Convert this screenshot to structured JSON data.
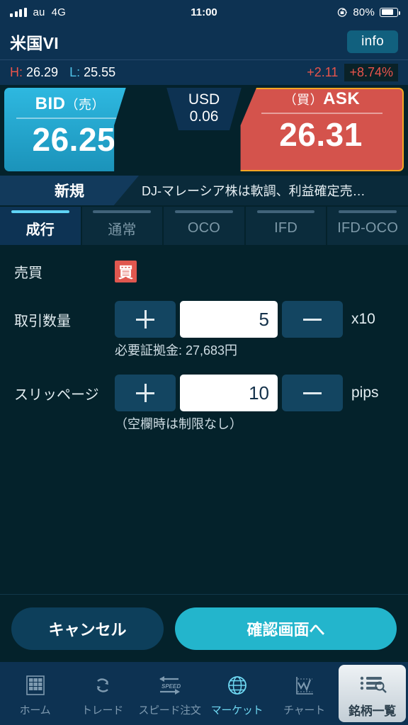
{
  "status_bar": {
    "carrier": "au",
    "network": "4G",
    "time": "11:00",
    "battery_percent": "80%",
    "battery_level": 80,
    "signal_bars": 4,
    "rotation_lock_icon": "rotation-lock-icon"
  },
  "header": {
    "symbol": "米国VI",
    "info_label": "info"
  },
  "hl_bar": {
    "high_label": "H:",
    "high_value": "26.29",
    "low_label": "L:",
    "low_value": "25.55",
    "change_abs": "+2.11",
    "change_pct": "+8.74%",
    "up_color": "#e8544b",
    "low_color": "#4fc3e8"
  },
  "quote": {
    "bid_label": "BID",
    "bid_label_sub": "（売）",
    "bid_price": "26.25",
    "ask_label": "ASK",
    "ask_label_sub": "（買）",
    "ask_price": "26.31",
    "spread_currency": "USD",
    "spread_value": "0.06",
    "bid_color": "#2eb8e0",
    "ask_color": "#d4534c",
    "ask_border_color": "#f5a623"
  },
  "news_row": {
    "shinki_label": "新規",
    "news_text": "DJ-マレーシア株は軟調、利益確定売…"
  },
  "order_tabs": [
    {
      "label": "成行",
      "active": true
    },
    {
      "label": "通常",
      "active": false
    },
    {
      "label": "OCO",
      "active": false
    },
    {
      "label": "IFD",
      "active": false
    },
    {
      "label": "IFD-OCO",
      "active": false
    }
  ],
  "form": {
    "side_label": "売買",
    "side_value": "買",
    "quantity_label": "取引数量",
    "quantity_value": "5",
    "quantity_unit": "x10",
    "quantity_note": "必要証拠金: 27,683円",
    "slippage_label": "スリッページ",
    "slippage_value": "10",
    "slippage_unit": "pips",
    "slippage_note": "（空欄時は制限なし）",
    "plus_icon": "plus-icon",
    "minus_icon": "minus-icon"
  },
  "actions": {
    "cancel_label": "キャンセル",
    "confirm_label": "確認画面へ"
  },
  "bottom_nav": [
    {
      "label": "ホーム",
      "icon": "grid-icon",
      "state": "inactive"
    },
    {
      "label": "トレード",
      "icon": "refresh-arrows-icon",
      "state": "inactive"
    },
    {
      "label": "スピード注文",
      "icon": "speed-arrows-icon",
      "state": "inactive"
    },
    {
      "label": "マーケット",
      "icon": "globe-icon",
      "state": "active"
    },
    {
      "label": "チャート",
      "icon": "chart-icon",
      "state": "inactive"
    },
    {
      "label": "銘柄一覧",
      "icon": "list-search-icon",
      "state": "selected"
    }
  ]
}
